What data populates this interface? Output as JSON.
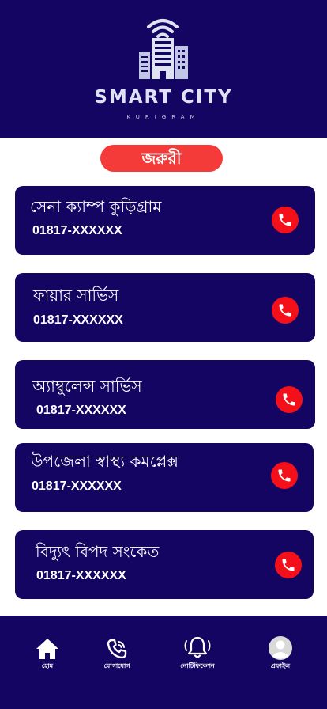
{
  "header": {
    "brand_title": "SMART CITY",
    "brand_subtitle": "KURIGRAM"
  },
  "section": {
    "title": "জরুরী"
  },
  "contacts": [
    {
      "name": "সেনা ক্যাম্প কুড়িগ্রাম",
      "phone": "01817-XXXXXX"
    },
    {
      "name": "ফায়ার সার্ভিস",
      "phone": "01817-XXXXXX"
    },
    {
      "name": "অ্যাম্বুলেন্স সার্ভিস",
      "phone": "01817-XXXXXX"
    },
    {
      "name": "উপজেলা স্বাস্থ্য কমপ্লেক্স",
      "phone": "01817-XXXXXX"
    },
    {
      "name": "বিদ্যুৎ বিপদ সংকেত",
      "phone": "01817-XXXXXX"
    }
  ],
  "bottom_nav": [
    {
      "label": "হোম",
      "icon": "home-icon"
    },
    {
      "label": "যোগাযোগ",
      "icon": "phone-icon"
    },
    {
      "label": "নোটিফিকেশন",
      "icon": "bell-icon"
    },
    {
      "label": "প্রফাইল",
      "icon": "profile-icon"
    }
  ],
  "colors": {
    "primary": "#140563",
    "accent": "#f53a3a",
    "call": "#f4101b"
  }
}
